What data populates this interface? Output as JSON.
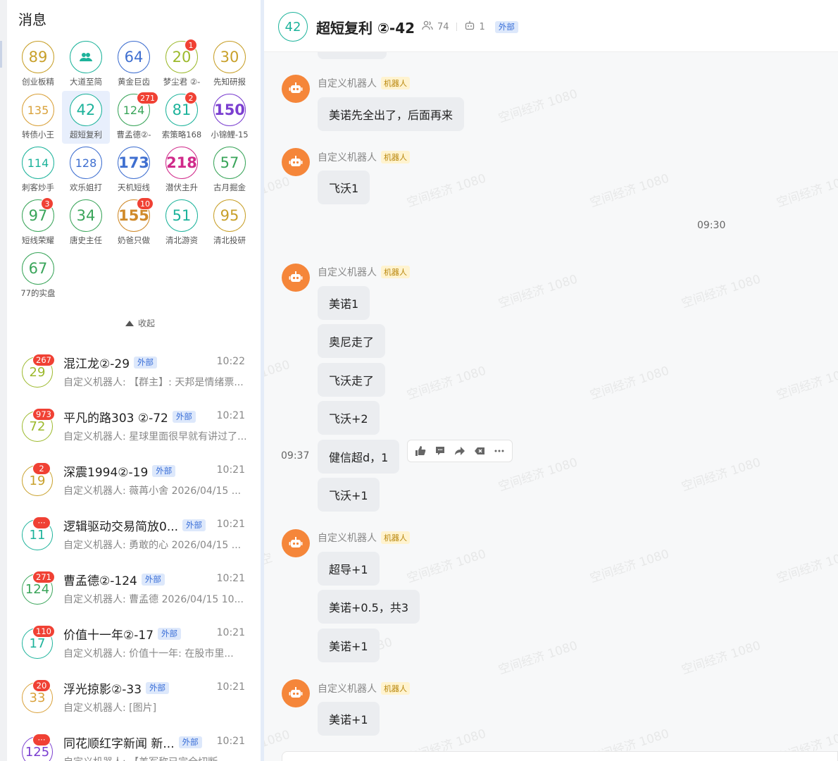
{
  "sidebar": {
    "title": "消息",
    "collapse_label": "收起",
    "groups": [
      {
        "count": "89",
        "label": "创业板精",
        "color": "#c8a02a"
      },
      {
        "count": "",
        "label": "大道至简",
        "color": "#1db39b",
        "icon": "group-icon"
      },
      {
        "count": "64",
        "label": "黄金巨齿",
        "color": "#3f6fd0"
      },
      {
        "count": "20",
        "label": "梦尘君 ②-",
        "color": "#9cb92c",
        "badge": "1"
      },
      {
        "count": "30",
        "label": "先知研报",
        "color": "#c8a02a"
      },
      {
        "count": "135",
        "label": "转债小王",
        "color": "#d9a13a"
      },
      {
        "count": "42",
        "label": "超短复利",
        "color": "#1db39b",
        "selected": true
      },
      {
        "count": "124",
        "label": "曹孟德②-",
        "color": "#3aa55a",
        "badge": "271"
      },
      {
        "count": "81",
        "label": "索策略168",
        "color": "#1db39b",
        "badge": "2"
      },
      {
        "count": "150",
        "label": "小锦鲤-15",
        "color": "#7b3fd0",
        "bold": true
      },
      {
        "count": "114",
        "label": "刺客炒手",
        "color": "#1db39b"
      },
      {
        "count": "128",
        "label": "欢乐姐打",
        "color": "#3f6fd0"
      },
      {
        "count": "173",
        "label": "天机短线",
        "color": "#3f6fd0",
        "bold": true
      },
      {
        "count": "218",
        "label": "潜伏主升",
        "color": "#d02a8a",
        "bold": true
      },
      {
        "count": "57",
        "label": "古月掘金",
        "color": "#3aa55a"
      },
      {
        "count": "97",
        "label": "短线荣耀",
        "color": "#3aa55a",
        "badge": "3"
      },
      {
        "count": "34",
        "label": "唐史主任",
        "color": "#3aa55a"
      },
      {
        "count": "155",
        "label": "奶爸只做",
        "color": "#d08a2a",
        "badge": "10",
        "bold": true
      },
      {
        "count": "51",
        "label": "清北游资",
        "color": "#1db39b"
      },
      {
        "count": "95",
        "label": "清北投研",
        "color": "#c8a02a"
      },
      {
        "count": "67",
        "label": "77的实盘",
        "color": "#3aa55a"
      }
    ]
  },
  "chat_list": [
    {
      "avatar": "29",
      "avatar_color": "#9cb92c",
      "badge": "267",
      "name": "混江龙②-29",
      "tag": "外部",
      "time": "10:22",
      "preview": "自定义机器人: 【群主】: 天邦是情绪票..."
    },
    {
      "avatar": "72",
      "avatar_color": "#9cb92c",
      "badge": "973",
      "name": "平凡的路303 ②-72",
      "tag": "外部",
      "time": "10:21",
      "preview": "自定义机器人: 星球里面很早就有讲过了..."
    },
    {
      "avatar": "19",
      "avatar_color": "#c8a02a",
      "badge": "2",
      "name": "深震1994②-19",
      "tag": "外部",
      "time": "10:21",
      "preview": "自定义机器人: 薇苒小舍 2026/04/15 ..."
    },
    {
      "avatar": "11",
      "avatar_color": "#1db39b",
      "badge": "···",
      "name": "逻辑驱动交易简放0...",
      "tag": "外部",
      "time": "10:21",
      "preview": "自定义机器人: 勇敢的心 2026/04/15 ..."
    },
    {
      "avatar": "124",
      "avatar_color": "#3aa55a",
      "badge": "271",
      "name": "曹孟德②-124",
      "tag": "外部",
      "time": "10:21",
      "preview": "自定义机器人: 曹孟德 2026/04/15 10..."
    },
    {
      "avatar": "17",
      "avatar_color": "#1db39b",
      "badge": "110",
      "name": "价值十一年②-17",
      "tag": "外部",
      "time": "10:21",
      "preview": "自定义机器人: 价值十一年: 在股市里..."
    },
    {
      "avatar": "33",
      "avatar_color": "#d9a13a",
      "badge": "20",
      "name": "浮光掠影②-33",
      "tag": "外部",
      "time": "10:21",
      "preview": "自定义机器人: [图片]"
    },
    {
      "avatar": "125",
      "avatar_color": "#7b3fd0",
      "badge": "···",
      "name": "同花顺红字新闻 新...",
      "tag": "外部",
      "time": "10:21",
      "preview": "自定义机器人: 【美军称已完全切断..."
    }
  ],
  "chat": {
    "avatar": "42",
    "title": "超短复利 ②-42",
    "members": "74",
    "bots": "1",
    "tag": "外部",
    "sender_name": "自定义机器人",
    "robot_tag": "机器人",
    "time_divider": "09:30",
    "hover_time": "09:37",
    "messages": [
      "美诺先全出了，后面再来",
      "飞沃1",
      "美诺1",
      "奥尼走了",
      "飞沃走了",
      "飞沃+2",
      "健信超d，1",
      "飞沃+1",
      "超导+1",
      "美诺+0.5，共3",
      "美诺+1",
      "美诺+1"
    ]
  },
  "watermark": "空间经济 1080",
  "watermark_fragments": [
    "1080",
    "030",
    "空"
  ]
}
